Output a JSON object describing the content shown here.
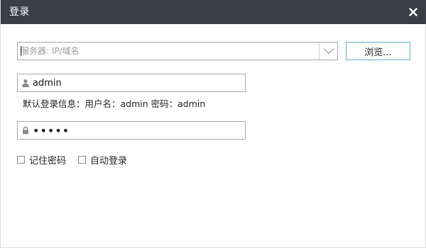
{
  "window": {
    "title": "登录"
  },
  "server": {
    "value": "",
    "placeholder": "服务器: IP/域名",
    "browse_label": "浏览..."
  },
  "username": {
    "value": "admin",
    "icon": "user-icon"
  },
  "hint": "默认登录信息：用户名：admin 密码：admin",
  "password": {
    "value": "admin",
    "icon": "lock-icon"
  },
  "options": {
    "remember_label": "记住密码",
    "remember_checked": false,
    "autologin_label": "自动登录",
    "autologin_checked": false
  }
}
